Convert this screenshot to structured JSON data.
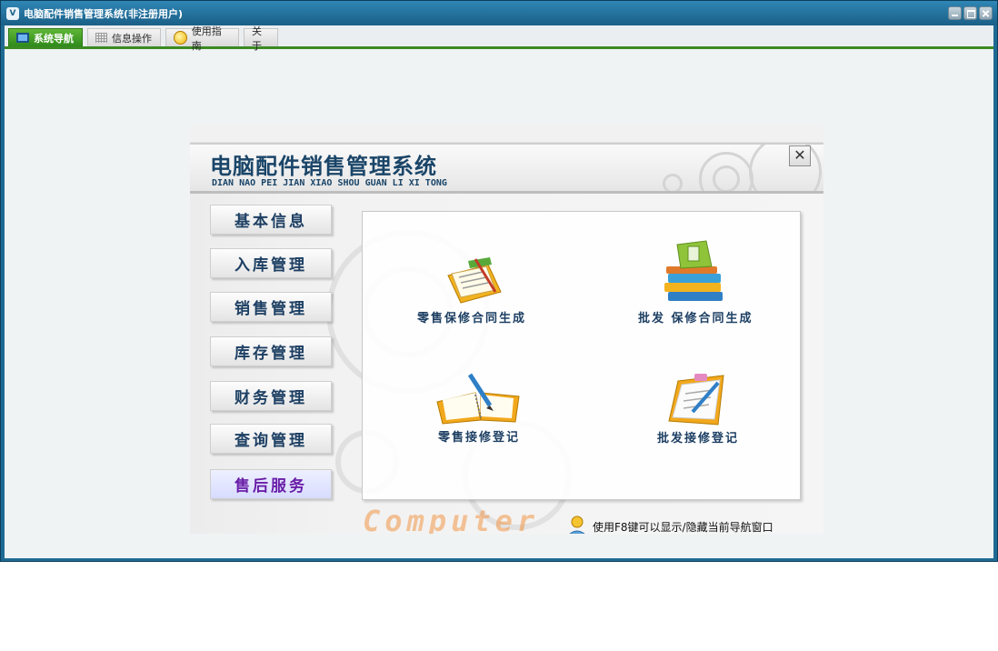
{
  "window": {
    "title": "电脑配件销售管理系统(非注册用户)",
    "icon_name": "app-logo-icon",
    "controls": [
      "minimize",
      "maximize",
      "close"
    ]
  },
  "tabs": [
    {
      "label": "系统导航",
      "icon": "monitor-icon",
      "active": true
    },
    {
      "label": "信息操作",
      "icon": "grid-icon",
      "active": false
    },
    {
      "label": "使用指南",
      "icon": "smiley-icon",
      "active": false
    },
    {
      "label": "关于",
      "icon": "",
      "active": false
    }
  ],
  "panel": {
    "title": "电脑配件销售管理系统",
    "subtitle": "DIAN NAO PEI JIAN XIAO SHOU GUAN LI XI TONG",
    "close_label": "✕",
    "menu": [
      {
        "label": "基本信息",
        "active": false
      },
      {
        "label": "入库管理",
        "active": false
      },
      {
        "label": "销售管理",
        "active": false
      },
      {
        "label": "库存管理",
        "active": false
      },
      {
        "label": "财务管理",
        "active": false
      },
      {
        "label": "查询管理",
        "active": false
      },
      {
        "label": "售后服务",
        "active": true
      }
    ],
    "functions": [
      {
        "label": "零售保修合同生成",
        "icon": "contract-documents-icon"
      },
      {
        "label": "批发 保修合同生成",
        "icon": "book-stack-icon"
      },
      {
        "label": "零售接修登记",
        "icon": "open-notebook-pen-icon"
      },
      {
        "label": "批发接修登记",
        "icon": "clipboard-pen-icon"
      }
    ],
    "footer_logo": "Computer",
    "footer_hint": "使用F8键可以显示/隐藏当前导航窗口"
  },
  "colors": {
    "titlebar": "#1f6a93",
    "tab_active": "#3b8a23",
    "menu_text": "#1d3f63",
    "menu_active_text": "#6a1ea8"
  }
}
